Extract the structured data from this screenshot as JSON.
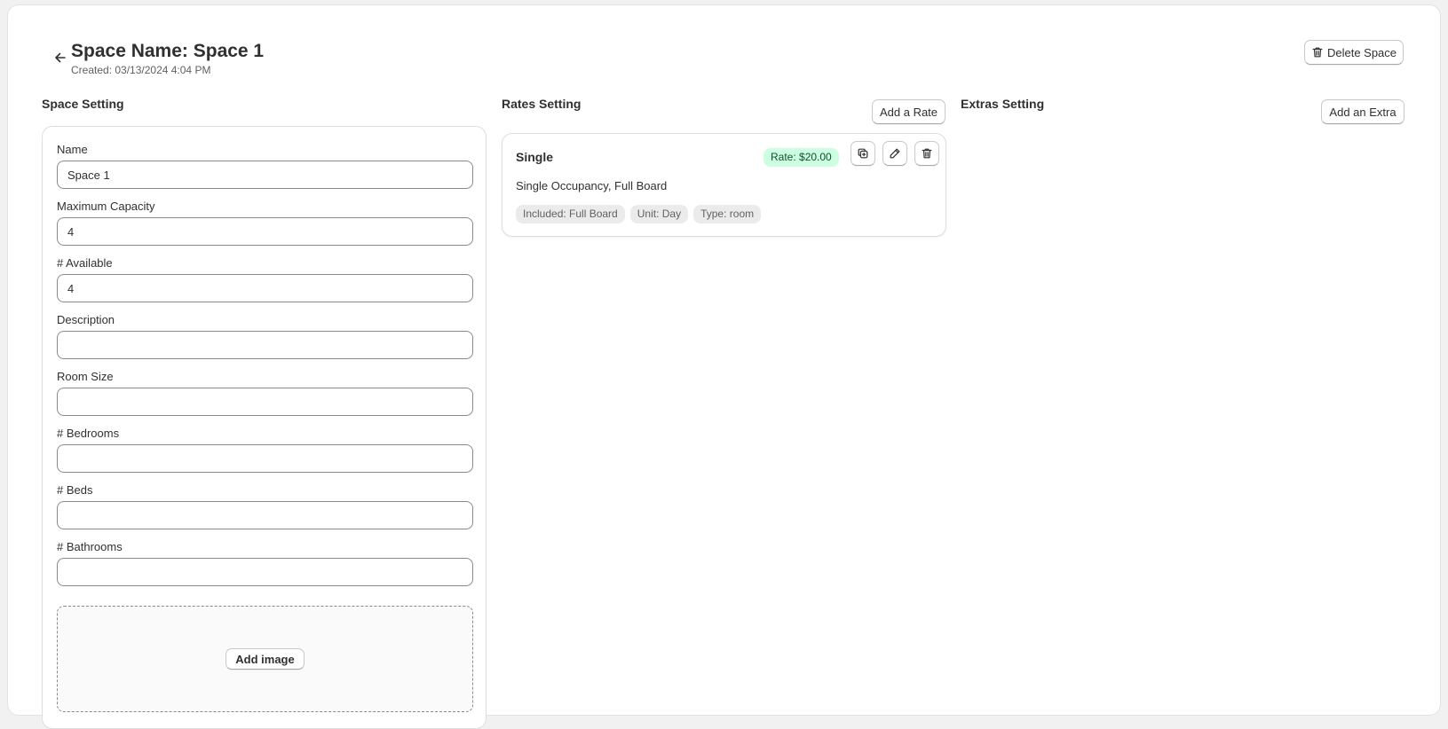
{
  "header": {
    "title": "Space Name: Space 1",
    "created": "Created: 03/13/2024 4:04 PM",
    "delete_label": "Delete Space"
  },
  "sections": {
    "space_title": "Space Setting",
    "rates_title": "Rates Setting",
    "extras_title": "Extras Setting",
    "add_rate_label": "Add a Rate",
    "add_extra_label": "Add an Extra"
  },
  "space_form": {
    "fields": [
      {
        "label": "Name",
        "value": "Space 1"
      },
      {
        "label": "Maximum Capacity",
        "value": "4"
      },
      {
        "label": "# Available",
        "value": "4"
      },
      {
        "label": "Description",
        "value": ""
      },
      {
        "label": "Room Size",
        "value": ""
      },
      {
        "label": "# Bedrooms",
        "value": ""
      },
      {
        "label": "# Beds",
        "value": ""
      },
      {
        "label": "# Bathrooms",
        "value": ""
      }
    ],
    "add_image_label": "Add image"
  },
  "rates": [
    {
      "name": "Single",
      "badge": "Rate: $20.00",
      "description": "Single Occupancy, Full Board",
      "tags": [
        "Included: Full Board",
        "Unit: Day",
        "Type: room"
      ]
    }
  ],
  "colors": {
    "badge_bg": "#cdfee1",
    "badge_text": "#0c5132",
    "tag_bg": "#ebebeb"
  },
  "icons": {
    "back": "arrow-left-icon",
    "delete": "trash-icon",
    "duplicate": "duplicate-icon",
    "edit": "pencil-icon"
  }
}
